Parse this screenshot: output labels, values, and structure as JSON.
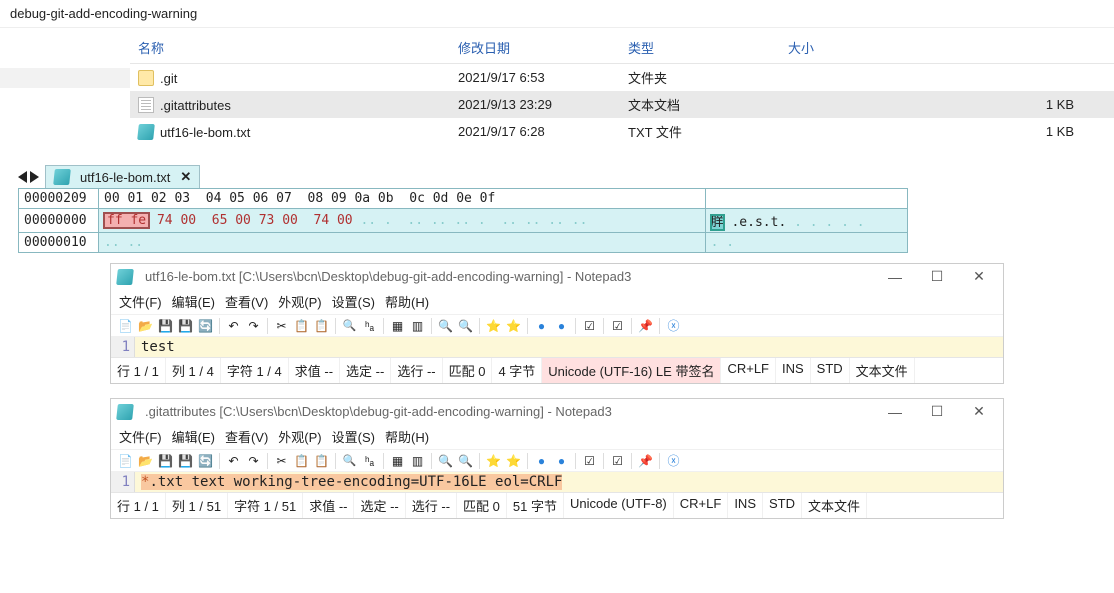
{
  "path": "debug-git-add-encoding-warning",
  "columns": {
    "name": "名称",
    "date": "修改日期",
    "type": "类型",
    "size": "大小"
  },
  "rows": [
    {
      "icon": "folder",
      "name": ".git",
      "date": "2021/9/17 6:53",
      "type": "文件夹",
      "size": "",
      "sel": false
    },
    {
      "icon": "doc",
      "name": ".gitattributes",
      "date": "2021/9/13 23:29",
      "type": "文本文档",
      "size": "1 KB",
      "sel": true
    },
    {
      "icon": "txt",
      "name": "utf16-le-bom.txt",
      "date": "2021/9/17 6:28",
      "type": "TXT 文件",
      "size": "1 KB",
      "sel": false
    }
  ],
  "hex": {
    "tab": "utf16-le-bom.txt",
    "total": "00000209",
    "header": "00 01 02 03  04 05 06 07  08 09 0a 0b  0c 0d 0e 0f",
    "r0": {
      "addr": "00000000",
      "bom": "ff fe",
      "rest": "74 00  65 00 73 00  74 00",
      "ascii_sel": "羘",
      "ascii_rest": ".e.s.t."
    },
    "r1": {
      "addr": "00000010"
    }
  },
  "np1": {
    "title": "utf16-le-bom.txt [C:\\Users\\bcn\\Desktop\\debug-git-add-encoding-warning] - Notepad3",
    "content": "test",
    "status": {
      "line": "行 1 / 1",
      "col": "列 1 / 4",
      "char": "字符 1 / 4",
      "eval": "求值 --",
      "seld": "选定 --",
      "row": "选行 --",
      "match": "匹配 0",
      "bytes": "4 字节",
      "enc": "Unicode (UTF-16) LE 带签名",
      "eol": "CR+LF",
      "ins": "INS",
      "std": "STD",
      "ft": "文本文件"
    }
  },
  "np2": {
    "title": ".gitattributes [C:\\Users\\bcn\\Desktop\\debug-git-add-encoding-warning] - Notepad3",
    "content_star": "*",
    "content_rest": ".txt  text working-tree-encoding=UTF-16LE eol=CRLF",
    "status": {
      "line": "行 1 / 1",
      "col": "列 1 / 51",
      "char": "字符 1 / 51",
      "eval": "求值 --",
      "seld": "选定 --",
      "row": "选行 --",
      "match": "匹配 0",
      "bytes": "51 字节",
      "enc": "Unicode (UTF-8)",
      "eol": "CR+LF",
      "ins": "INS",
      "std": "STD",
      "ft": "文本文件"
    }
  },
  "menu": {
    "file": "文件(F)",
    "edit": "编辑(E)",
    "view": "查看(V)",
    "appearance": "外观(P)",
    "settings": "设置(S)",
    "help": "帮助(H)"
  }
}
